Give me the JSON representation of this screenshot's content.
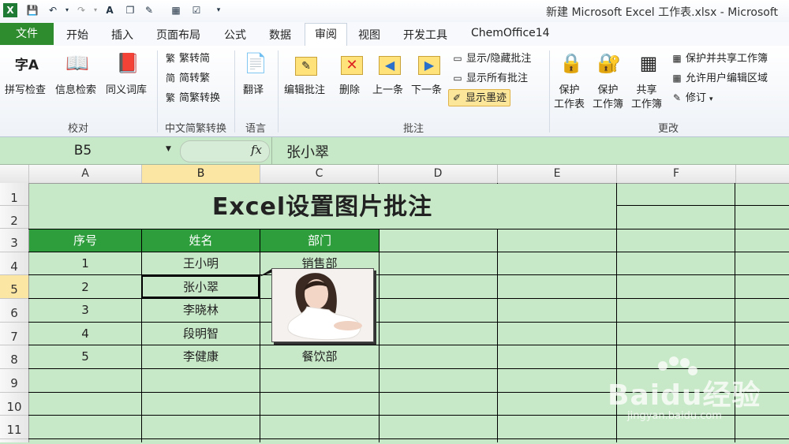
{
  "window": {
    "title": "新建 Microsoft Excel 工作表.xlsx - Microsoft"
  },
  "tabs": {
    "file": "文件",
    "home": "开始",
    "insert": "插入",
    "layout": "页面布局",
    "formula": "公式",
    "data": "数据",
    "review": "审阅",
    "view": "视图",
    "developer": "开发工具",
    "chemoffice": "ChemOffice14"
  },
  "ribbon": {
    "proofing": {
      "label": "校对",
      "spell": "拼写检查",
      "research": "信息检索",
      "thesaurus": "同义词库"
    },
    "chinese": {
      "label": "中文简繁转换",
      "to_simplified": "繁转简",
      "to_traditional": "简转繁",
      "convert": "简繁转换"
    },
    "language": {
      "label": "语言",
      "translate": "翻译"
    },
    "comments": {
      "label": "批注",
      "edit": "编辑批注",
      "delete": "删除",
      "previous": "上一条",
      "next": "下一条",
      "show_hide": "显示/隐藏批注",
      "show_all": "显示所有批注",
      "show_ink": "显示墨迹"
    },
    "changes": {
      "label": "更改",
      "protect_sheet_1": "保护",
      "protect_sheet_2": "工作表",
      "protect_book_1": "保护",
      "protect_book_2": "工作簿",
      "share_book_1": "共享",
      "share_book_2": "工作簿",
      "protect_share": "保护并共享工作簿",
      "allow_edit": "允许用户编辑区域",
      "track": "修订"
    }
  },
  "formula_bar": {
    "name_box": "B5",
    "fx": "fx",
    "value": "张小翠"
  },
  "columns": [
    "A",
    "B",
    "C",
    "D",
    "E",
    "F"
  ],
  "rows": [
    "1",
    "2",
    "3",
    "4",
    "5",
    "6",
    "7",
    "8",
    "9",
    "10",
    "11"
  ],
  "sheet": {
    "title": "Excel设置图片批注",
    "headers": [
      "序号",
      "姓名",
      "部门"
    ],
    "data": [
      [
        "1",
        "王小明",
        "销售部"
      ],
      [
        "2",
        "张小翠",
        ""
      ],
      [
        "3",
        "李晓林",
        ""
      ],
      [
        "4",
        "段明智",
        ""
      ],
      [
        "5",
        "李健康",
        "餐饮部"
      ]
    ]
  },
  "watermark": {
    "brand": "Baidu经验",
    "url": "jingyan.baidu.com"
  },
  "colors": {
    "sheet_bg": "#c8e9c8",
    "header_green": "#2e9e3c",
    "file_tab": "#2e8b2e",
    "selection": "#fce6a4"
  }
}
